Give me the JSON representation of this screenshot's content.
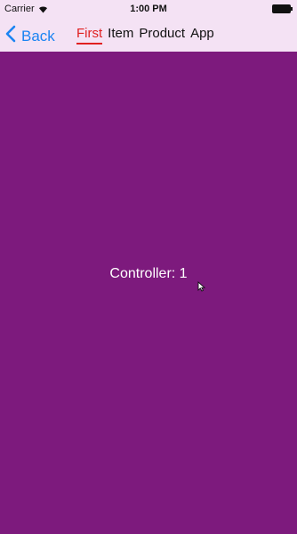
{
  "status_bar": {
    "carrier": "Carrier",
    "time": "1:00 PM"
  },
  "nav": {
    "back_label": "Back",
    "accent_color": "#1b84f2"
  },
  "tabs": [
    {
      "label": "First",
      "active": true
    },
    {
      "label": "Item",
      "active": false
    },
    {
      "label": "Product",
      "active": false
    },
    {
      "label": "App",
      "active": false
    }
  ],
  "content": {
    "label": "Controller: 1",
    "background_color": "#7d1a7d"
  },
  "colors": {
    "header_background": "#f4e2f4",
    "active_tab": "#e02020"
  }
}
